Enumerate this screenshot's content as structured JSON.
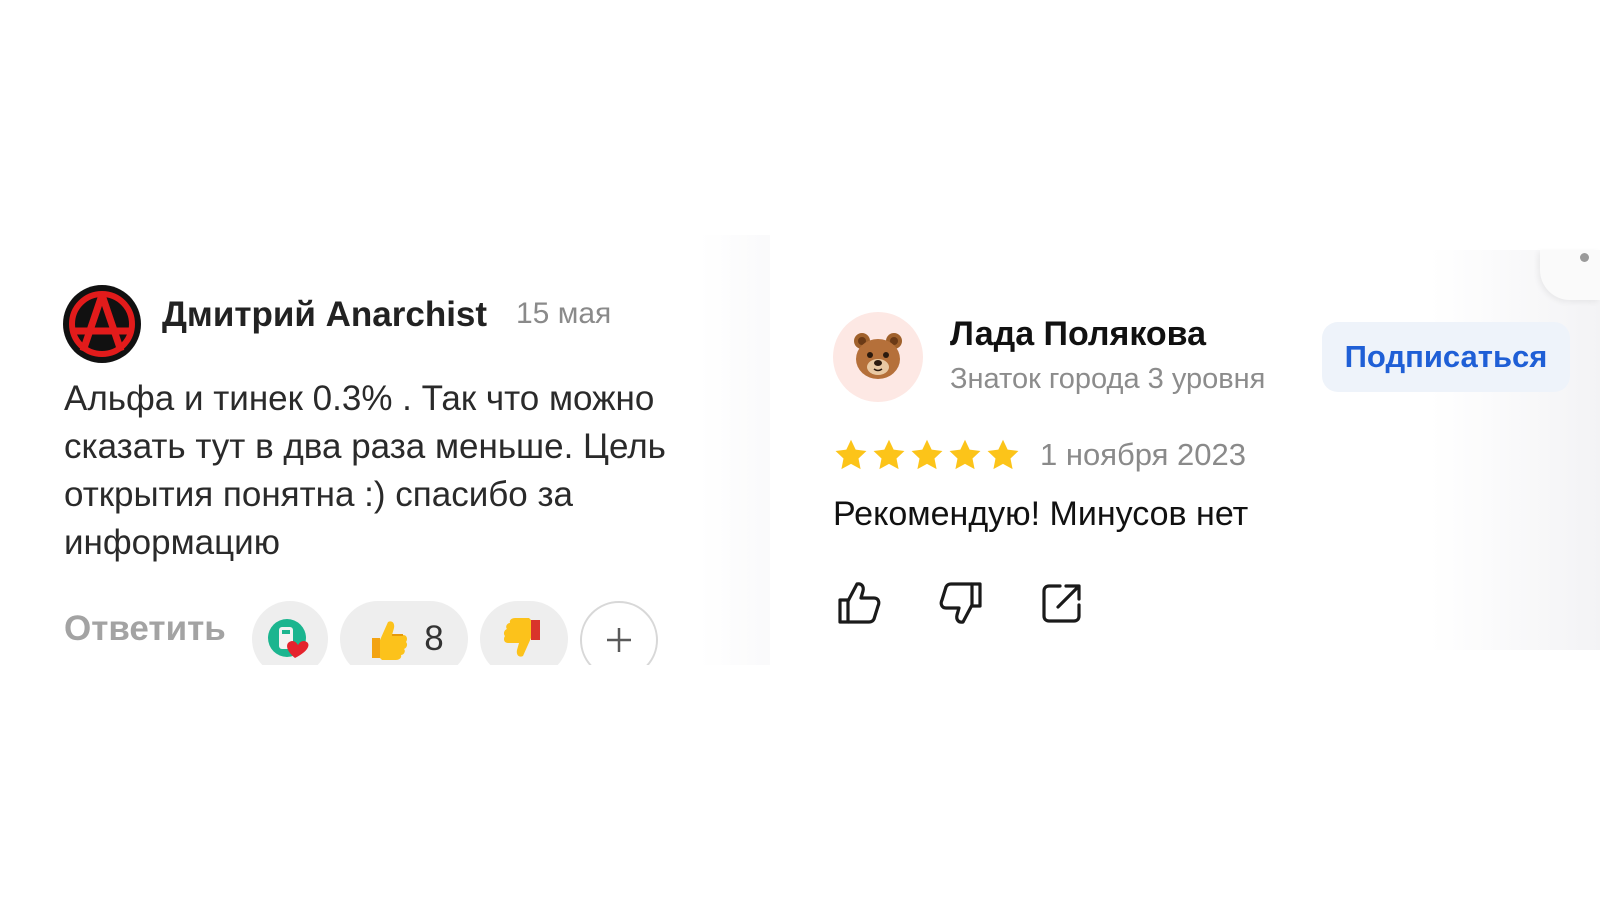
{
  "comment": {
    "author": "Дмитрий Anarchist",
    "date": "15 мая",
    "text": "Альфа и тинек 0.3% . Так что можно сказать тут в два раза меньше. Цель открытия понятна :) спасибо за информацию",
    "reply_label": "Ответить",
    "reactions": [
      {
        "icon": "heart-sticker-icon",
        "count": null
      },
      {
        "icon": "thumbs-up-emoji-icon",
        "count": "8"
      },
      {
        "icon": "thumbs-down-emoji-icon",
        "count": null
      }
    ],
    "add_reaction_icon": "plus-icon"
  },
  "review": {
    "avatar_icon": "bear-face-icon",
    "name": "Лада Полякова",
    "level": "Знаток города 3 уровня",
    "subscribe_label": "Подписаться",
    "rating": 5,
    "rating_max": 5,
    "date": "1 ноября 2023",
    "text": "Рекомендую! Минусов нет",
    "actions": [
      "like-icon",
      "dislike-icon",
      "share-icon"
    ]
  },
  "colors": {
    "accent_blue": "#1f5fd6",
    "star": "#fcc419",
    "anarchy_red": "#e21b1b",
    "muted_text": "#8a8a8a"
  }
}
